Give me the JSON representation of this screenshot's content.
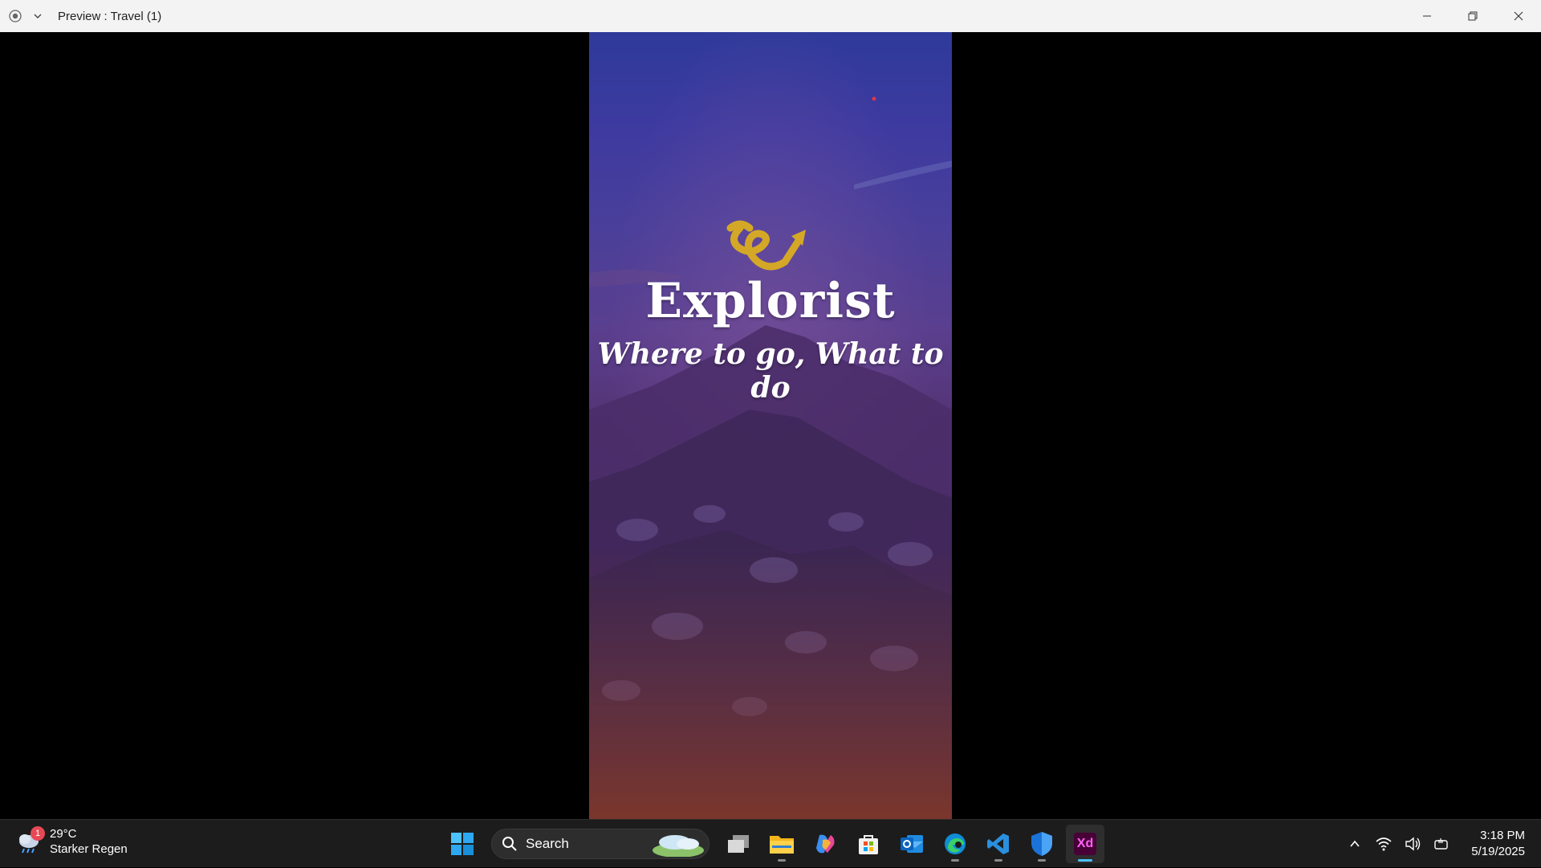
{
  "window": {
    "title": "Preview : Travel (1)"
  },
  "artboard": {
    "app_name": "Explorist",
    "tagline": "Where to go, What to do"
  },
  "taskbar": {
    "weather": {
      "badge": "1",
      "temperature": "29°C",
      "condition": "Starker Regen"
    },
    "search": {
      "label": "Search"
    },
    "apps": [
      {
        "name": "Start",
        "icon": "windows-start-icon"
      },
      {
        "name": "Task View",
        "icon": "task-view-icon"
      },
      {
        "name": "File Explorer",
        "icon": "folder-icon"
      },
      {
        "name": "Copilot",
        "icon": "copilot-icon"
      },
      {
        "name": "Microsoft Store",
        "icon": "store-icon"
      },
      {
        "name": "Outlook",
        "icon": "outlook-icon"
      },
      {
        "name": "Edge",
        "icon": "edge-icon"
      },
      {
        "name": "VS Code",
        "icon": "vscode-icon"
      },
      {
        "name": "Defender",
        "icon": "shield-icon"
      },
      {
        "name": "Adobe XD",
        "icon": "xd-icon",
        "label": "Xd"
      }
    ],
    "clock": {
      "time": "3:18 PM",
      "date": "5/19/2025"
    }
  },
  "colors": {
    "titlebar": "#f3f3f3",
    "taskbar": "#1c1c1c",
    "accent": "#4cc2ff",
    "logo": "#d4a826",
    "xd": "#ff61f6"
  }
}
